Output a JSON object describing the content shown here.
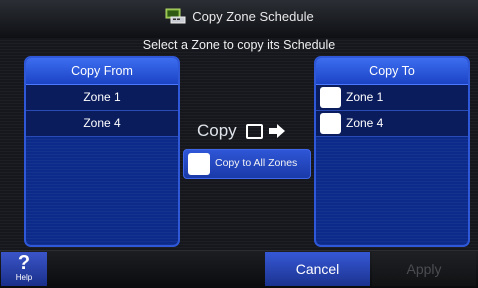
{
  "header": {
    "title": "Copy Zone Schedule",
    "icon": "schedule-icon"
  },
  "subtitle": "Select a Zone to copy its Schedule",
  "copy_from": {
    "heading": "Copy From",
    "zones": [
      "Zone 1",
      "Zone 4"
    ]
  },
  "copy_to": {
    "heading": "Copy To",
    "zones": [
      "Zone 1",
      "Zone 4"
    ]
  },
  "copy_label": "Copy",
  "copy_all": {
    "label": "Copy to All Zones"
  },
  "footer": {
    "help_symbol": "?",
    "help_label": "Help",
    "cancel_label": "Cancel",
    "apply_label": "Apply"
  },
  "colors": {
    "accent": "#2f58d8",
    "panel_bg": "#0b2a8a",
    "screen_bg": "#15171c"
  }
}
